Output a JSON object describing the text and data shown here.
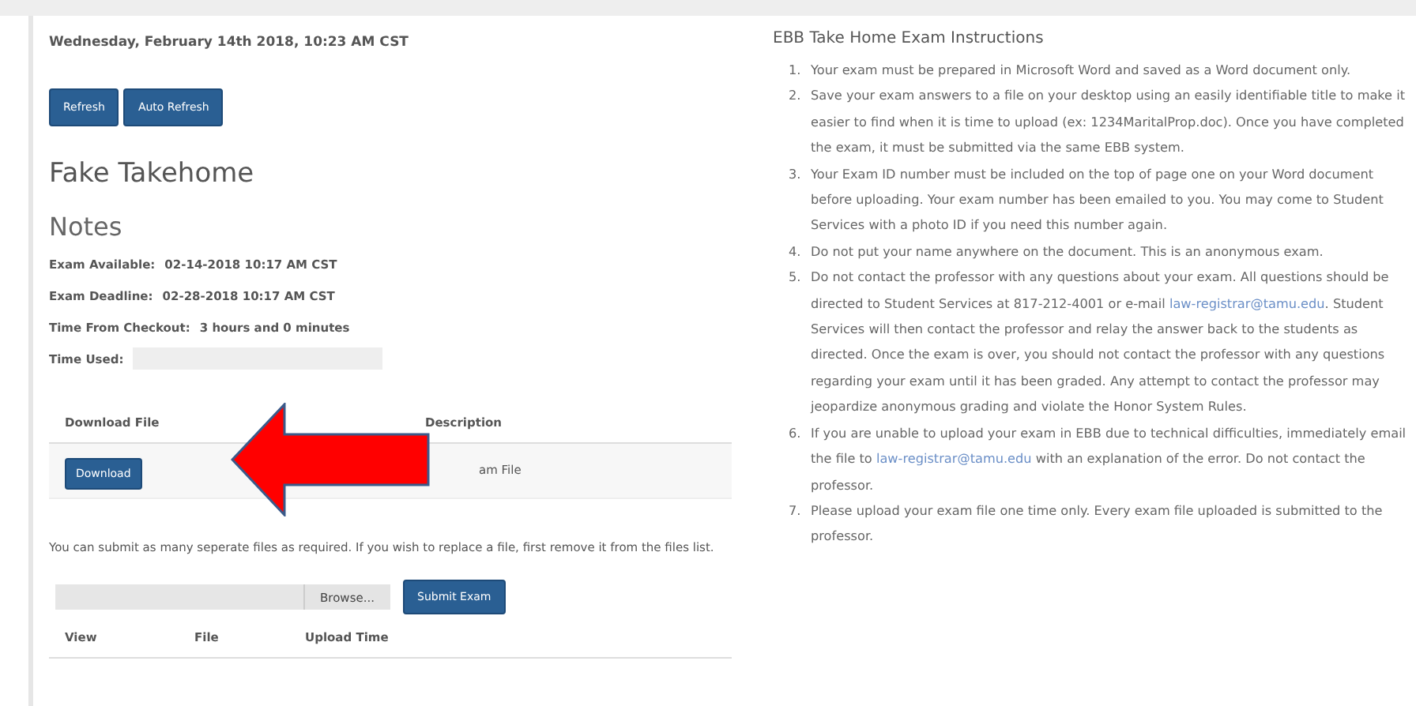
{
  "date_line": "Wednesday, February 14th 2018, 10:23 AM CST",
  "buttons": [
    {
      "label": "Refresh"
    },
    {
      "label": "Auto Refresh"
    }
  ],
  "exam_title": "Fake Takehome",
  "notes_heading": "Notes",
  "details": [
    {
      "label": "Exam Available:",
      "value": "02-14-2018 10:17 AM CST",
      "kind": "text"
    },
    {
      "label": "Exam Deadline:",
      "value": "02-28-2018 10:17 AM CST",
      "kind": "text"
    },
    {
      "label": "Time From Checkout:",
      "value": "3 hours and 0 minutes",
      "kind": "text"
    },
    {
      "label": "Time Used:",
      "kind": "bar"
    }
  ],
  "download_table": {
    "columns": [
      "Download File",
      "Description"
    ],
    "rows": [
      {
        "button": "Download",
        "description": "am File"
      }
    ]
  },
  "submit_note": "You can submit as many seperate files as required. If you wish to replace a file, first remove it from the files list.",
  "upload": {
    "browse": "Browse...",
    "submit": "Submit Exam"
  },
  "files_table": {
    "columns": [
      "View",
      "File",
      "Upload Time"
    ]
  },
  "instructions": {
    "title": "EBB Take Home Exam Instructions",
    "numbers": [
      "1.",
      "2.",
      "3.",
      "4.",
      "5.",
      "6.",
      "7."
    ],
    "items": [
      [
        {
          "text": "Your exam must be prepared in Microsoft Word and saved as a Word document only."
        }
      ],
      [
        {
          "text": "Save your exam answers to a file on your desktop using an easily identifiable title to make it easier to find when it is time to upload (ex: 1234MaritalProp.doc). Once you have completed the exam, it must be submitted via the same EBB system."
        }
      ],
      [
        {
          "text": "Your Exam ID number must be included on the top of page one on your Word document before uploading. Your exam number has been emailed to you. You may come to Student Services with a photo ID if you need this number again."
        }
      ],
      [
        {
          "text": "Do not put your name anywhere on the document. This is an anonymous exam."
        }
      ],
      [
        {
          "text": "Do not contact the professor with any questions about your exam. All questions should be directed to Student Services at 817-212-4001 or e-mail "
        },
        {
          "text": "law-registrar@tamu.edu",
          "link": true
        },
        {
          "text": ". Student Services will then contact the professor and relay the answer back to the students as directed. Once the exam is over, you should not contact the professor with any questions regarding your exam until it has been graded. Any attempt to contact the professor may jeopardize anonymous grading and violate the Honor System Rules."
        }
      ],
      [
        {
          "text": "If you are unable to upload your exam in EBB due to technical difficulties, immediately email the file to "
        },
        {
          "text": "law-registrar@tamu.edu",
          "link": true
        },
        {
          "text": " with an explanation of the error. Do not contact the professor."
        }
      ],
      [
        {
          "text": "Please upload your exam file one time only. Every exam file uploaded is submitted to the professor."
        }
      ]
    ]
  }
}
